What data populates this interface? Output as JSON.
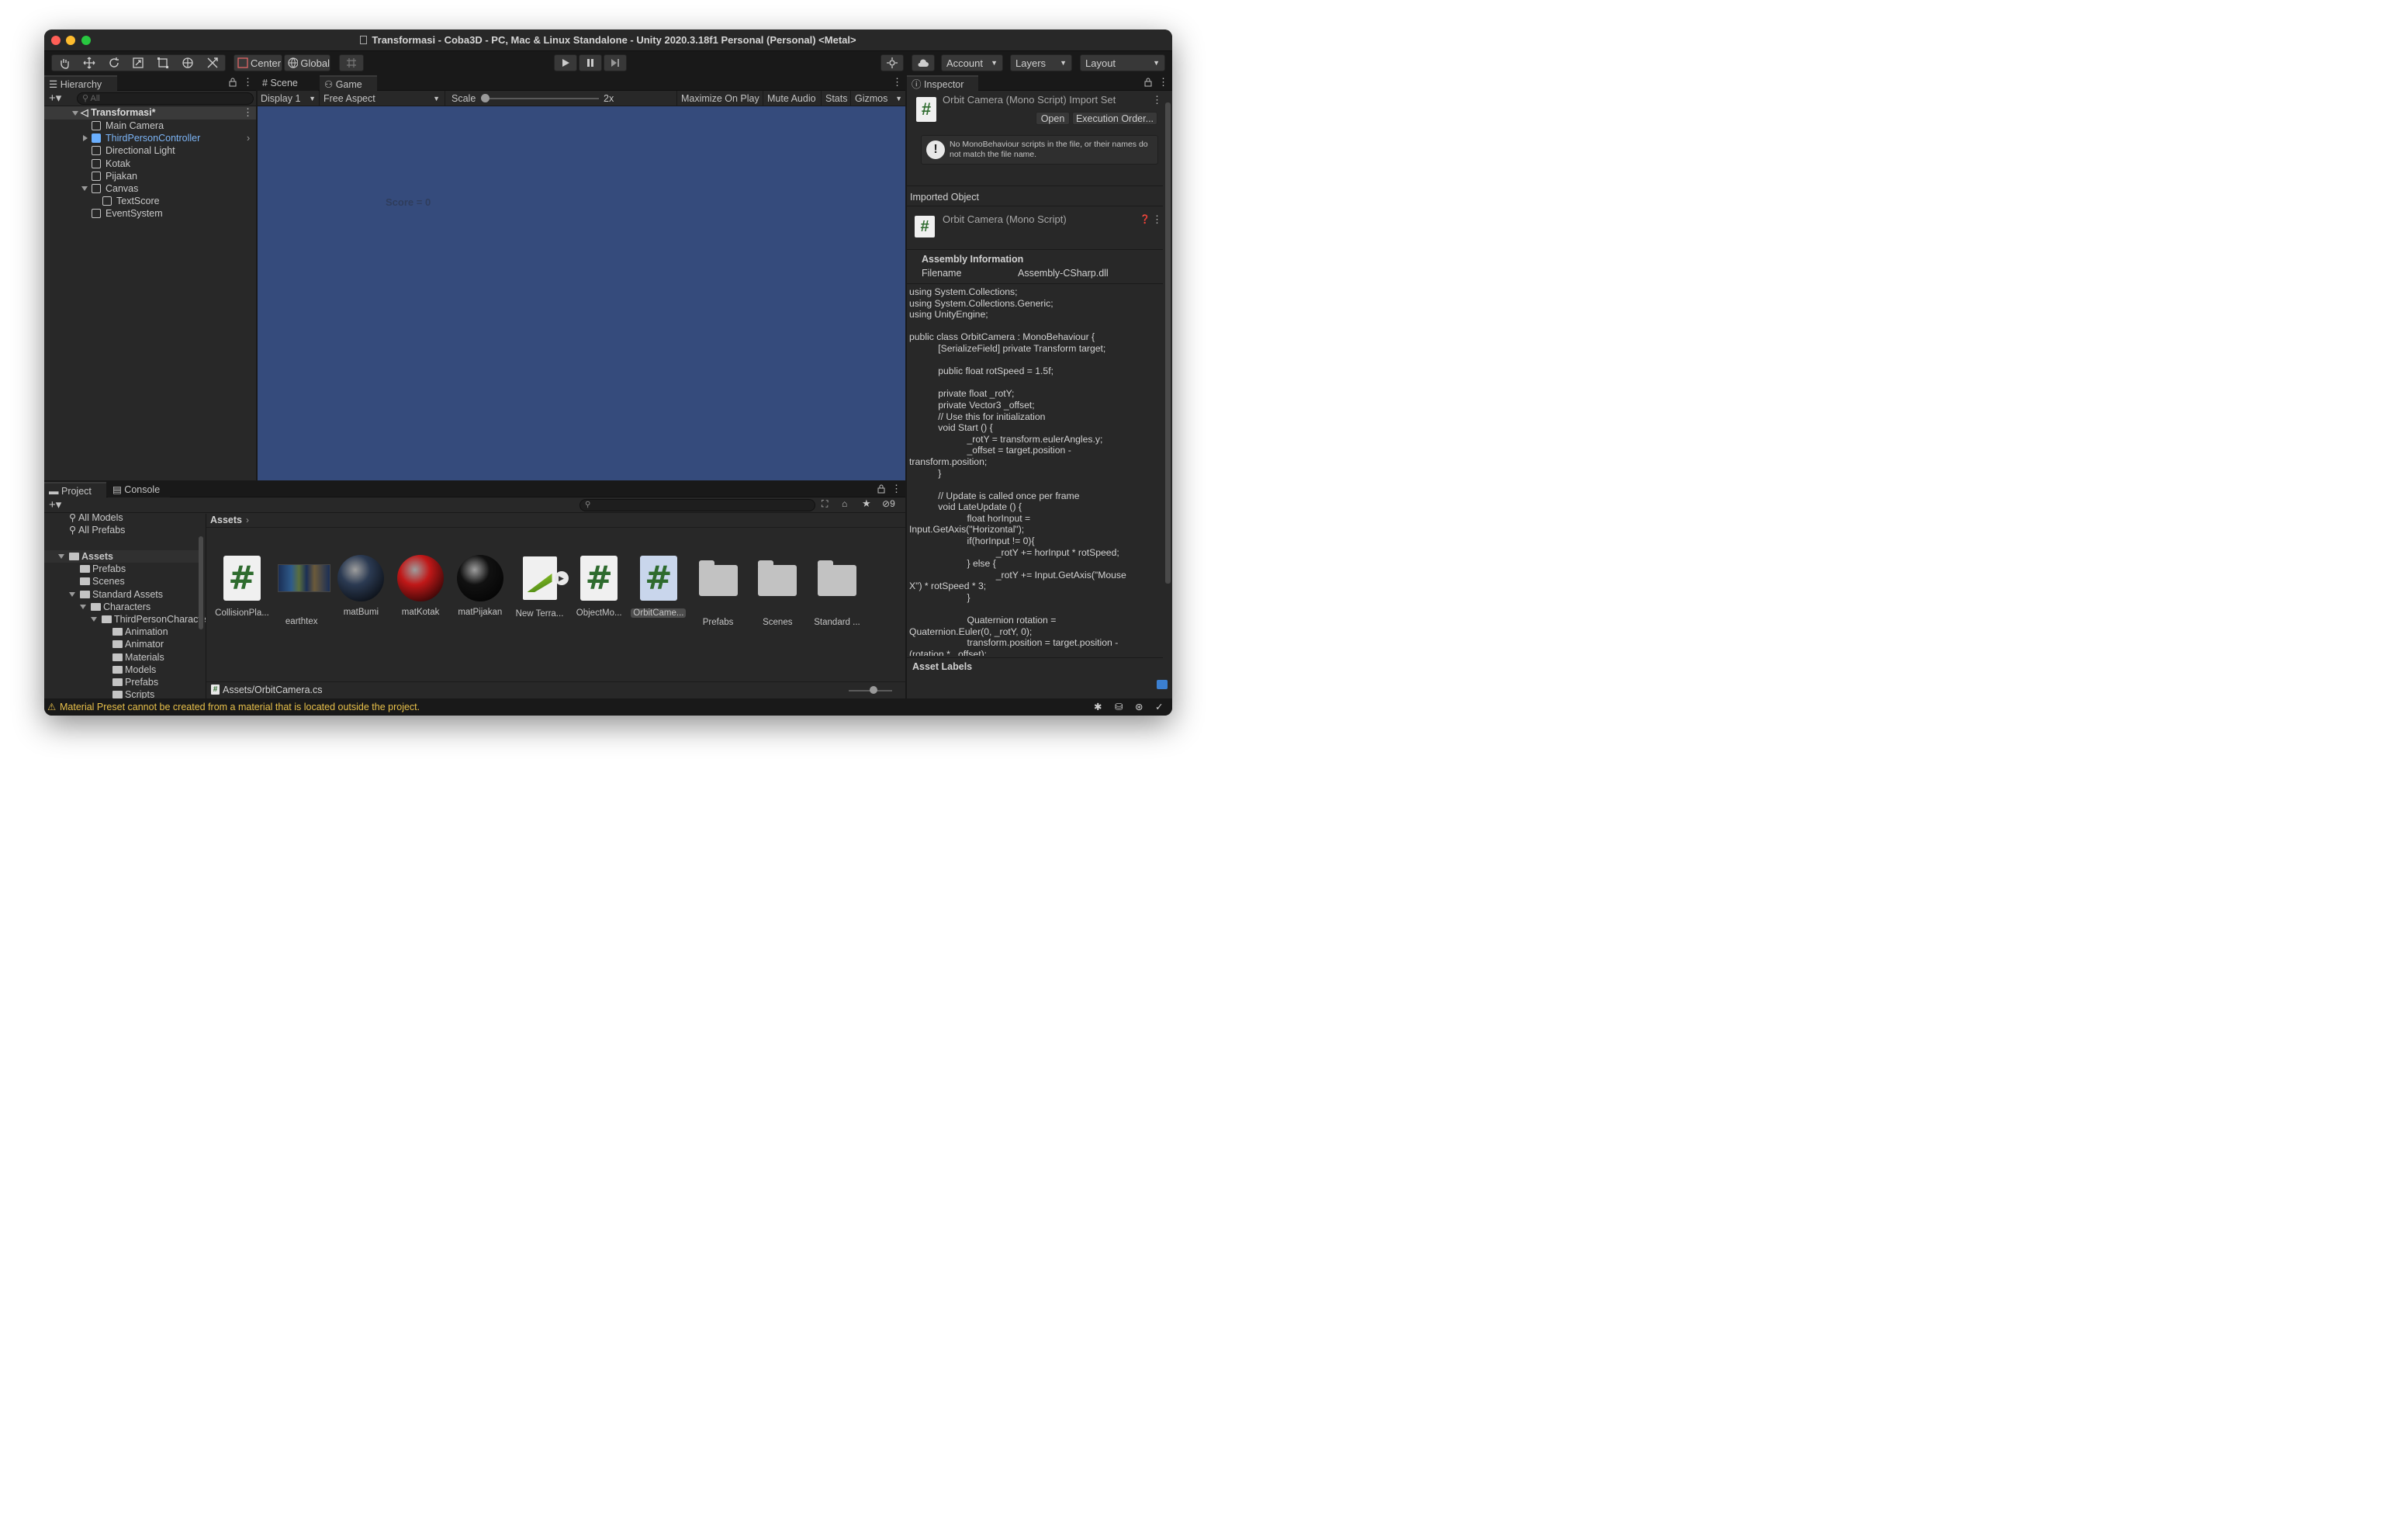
{
  "window": {
    "title": "Transformasi - Coba3D - PC, Mac & Linux Standalone - Unity 2020.3.18f1 Personal (Personal) <Metal>",
    "traffic": {
      "close": "#ff5f57",
      "min": "#febc2e",
      "max": "#28c840"
    }
  },
  "toolbar": {
    "tools": [
      "hand-icon",
      "move-icon",
      "rotate-icon",
      "scale-icon",
      "rect-icon",
      "transform-icon",
      "custom-tool-icon"
    ],
    "pivot_label": "Center",
    "space_label": "Global",
    "account_label": "Account",
    "layers_label": "Layers",
    "layout_label": "Layout"
  },
  "hierarchy": {
    "tab_label": "Hierarchy",
    "search_placeholder": "All",
    "scene": "Transformasi*",
    "items": [
      {
        "label": "Main Camera",
        "depth": 1,
        "expander": "none"
      },
      {
        "label": "ThirdPersonController",
        "depth": 1,
        "expander": "collapsed",
        "prefab": true
      },
      {
        "label": "Directional Light",
        "depth": 1,
        "expander": "none"
      },
      {
        "label": "Kotak",
        "depth": 1,
        "expander": "none"
      },
      {
        "label": "Pijakan",
        "depth": 1,
        "expander": "none"
      },
      {
        "label": "Canvas",
        "depth": 1,
        "expander": "expanded"
      },
      {
        "label": "TextScore",
        "depth": 2,
        "expander": "none"
      },
      {
        "label": "EventSystem",
        "depth": 1,
        "expander": "none"
      }
    ]
  },
  "game_view": {
    "tabs": [
      "Scene",
      "Game"
    ],
    "display": "Display 1",
    "aspect": "Free Aspect",
    "scale_label": "Scale",
    "scale_value": "2x",
    "maximize": "Maximize On Play",
    "mute": "Mute Audio",
    "stats": "Stats",
    "gizmos": "Gizmos",
    "score_text": "Score = 0",
    "background": "#354b7c"
  },
  "inspector": {
    "tab_label": "Inspector",
    "header_title": "Orbit Camera (Mono Script) Import Set",
    "open_label": "Open",
    "exec_label": "Execution Order...",
    "warning": "No MonoBehaviour scripts in the file, or their names do not match the file name.",
    "imported_object": "Imported Object",
    "object_title": "Orbit Camera (Mono Script)",
    "assembly_header": "Assembly Information",
    "filename_label": "Filename",
    "filename_value": "Assembly-CSharp.dll",
    "code": "using System.Collections;\nusing System.Collections.Generic;\nusing UnityEngine;\n\npublic class OrbitCamera : MonoBehaviour {\n           [SerializeField] private Transform target;\n\n           public float rotSpeed = 1.5f;\n\n           private float _rotY;\n           private Vector3 _offset;\n           // Use this for initialization\n           void Start () {\n                      _rotY = transform.eulerAngles.y;\n                      _offset = target.position -\ntransform.position;\n           }\n\n           // Update is called once per frame\n           void LateUpdate () {\n                      float horInput =\nInput.GetAxis(\"Horizontal\");\n                      if(horInput != 0){\n                                 _rotY += horInput * rotSpeed;\n                      } else {\n                                 _rotY += Input.GetAxis(\"Mouse\nX\") * rotSpeed * 3;\n                      }\n\n                      Quaternion rotation =\nQuaternion.Euler(0, _rotY, 0);\n                      transform.position = target.position -\n(rotation * _offset);",
    "asset_labels": "Asset Labels"
  },
  "project": {
    "tabs": [
      "Project",
      "Console"
    ],
    "hidden_count": "9",
    "favorites": [
      "All Models",
      "All Prefabs"
    ],
    "tree": [
      {
        "label": "Assets",
        "depth": 0,
        "expander": "expanded",
        "bold": true
      },
      {
        "label": "Prefabs",
        "depth": 1,
        "expander": "none"
      },
      {
        "label": "Scenes",
        "depth": 1,
        "expander": "none"
      },
      {
        "label": "Standard Assets",
        "depth": 1,
        "expander": "expanded"
      },
      {
        "label": "Characters",
        "depth": 2,
        "expander": "expanded"
      },
      {
        "label": "ThirdPersonCharacte",
        "depth": 3,
        "expander": "expanded"
      },
      {
        "label": "Animation",
        "depth": 4,
        "expander": "none"
      },
      {
        "label": "Animator",
        "depth": 4,
        "expander": "none"
      },
      {
        "label": "Materials",
        "depth": 4,
        "expander": "none"
      },
      {
        "label": "Models",
        "depth": 4,
        "expander": "none"
      },
      {
        "label": "Prefabs",
        "depth": 4,
        "expander": "none"
      },
      {
        "label": "Scripts",
        "depth": 4,
        "expander": "none"
      }
    ],
    "breadcrumb": "Assets",
    "assets": [
      {
        "label": "CollisionPla...",
        "kind": "script"
      },
      {
        "label": "earthtex",
        "kind": "texture"
      },
      {
        "label": "matBumi",
        "kind": "material",
        "color": "#2b3a52"
      },
      {
        "label": "matKotak",
        "kind": "material",
        "color": "#c01818"
      },
      {
        "label": "matPijakan",
        "kind": "material",
        "color": "#111111"
      },
      {
        "label": "New Terra...",
        "kind": "terrain"
      },
      {
        "label": "ObjectMo...",
        "kind": "script"
      },
      {
        "label": "OrbitCame...",
        "kind": "script",
        "selected": true
      },
      {
        "label": "Prefabs",
        "kind": "folder"
      },
      {
        "label": "Scenes",
        "kind": "folder"
      },
      {
        "label": "Standard ...",
        "kind": "folder"
      }
    ],
    "path": "Assets/OrbitCamera.cs"
  },
  "status": {
    "message": "Material Preset cannot be created from a material that is located outside the project."
  }
}
